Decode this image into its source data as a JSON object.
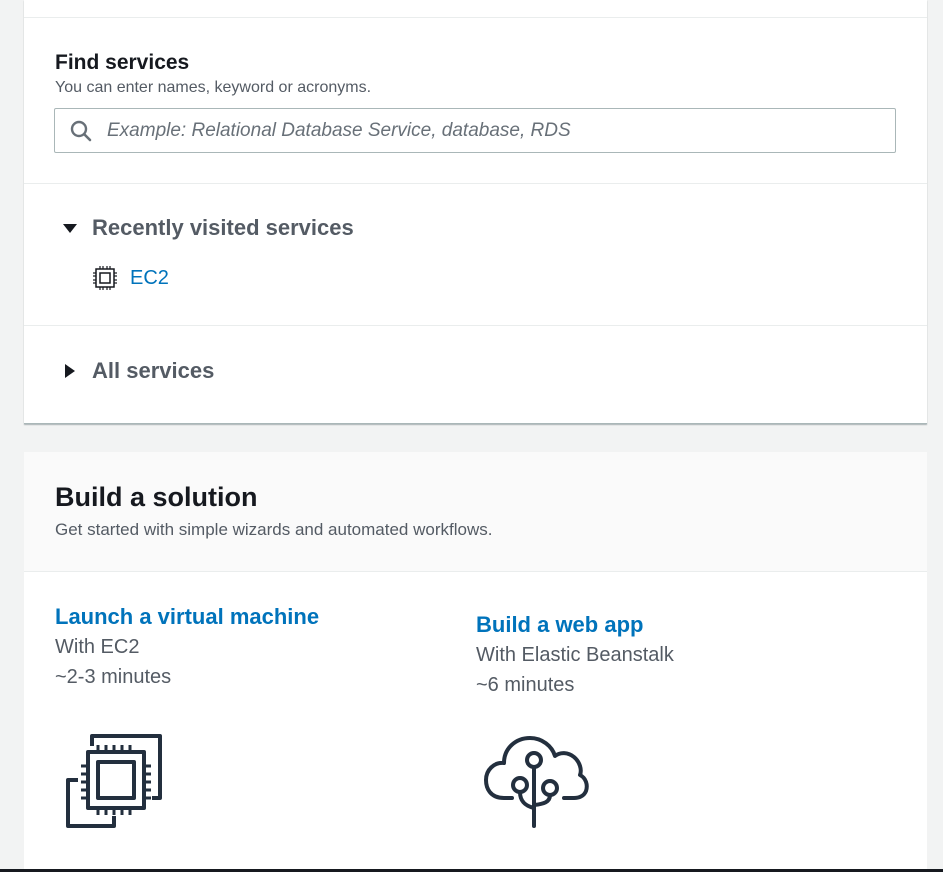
{
  "find_services": {
    "title": "Find services",
    "description": "You can enter names, keyword or acronyms.",
    "search": {
      "placeholder": "Example: Relational Database Service, database, RDS",
      "value": "",
      "icon": "search-icon"
    }
  },
  "recently_visited": {
    "label": "Recently visited services",
    "expanded": true,
    "items": [
      {
        "label": "EC2",
        "icon": "chip-icon"
      }
    ]
  },
  "all_services": {
    "label": "All services",
    "expanded": false
  },
  "build_solution": {
    "title": "Build a solution",
    "description": "Get started with simple wizards and automated workflows.",
    "cards": [
      {
        "title": "Launch a virtual machine",
        "subtitle": "With EC2",
        "time": "~2-3 minutes",
        "icon": "ec2-instances-icon"
      },
      {
        "title": "Build a web app",
        "subtitle": "With Elastic Beanstalk",
        "time": "~6 minutes",
        "icon": "cloud-tree-icon"
      }
    ]
  },
  "colors": {
    "link": "#0073bb",
    "text": "#16191f",
    "muted": "#545b64",
    "background": "#f2f3f3",
    "border": "#aab7b8"
  }
}
